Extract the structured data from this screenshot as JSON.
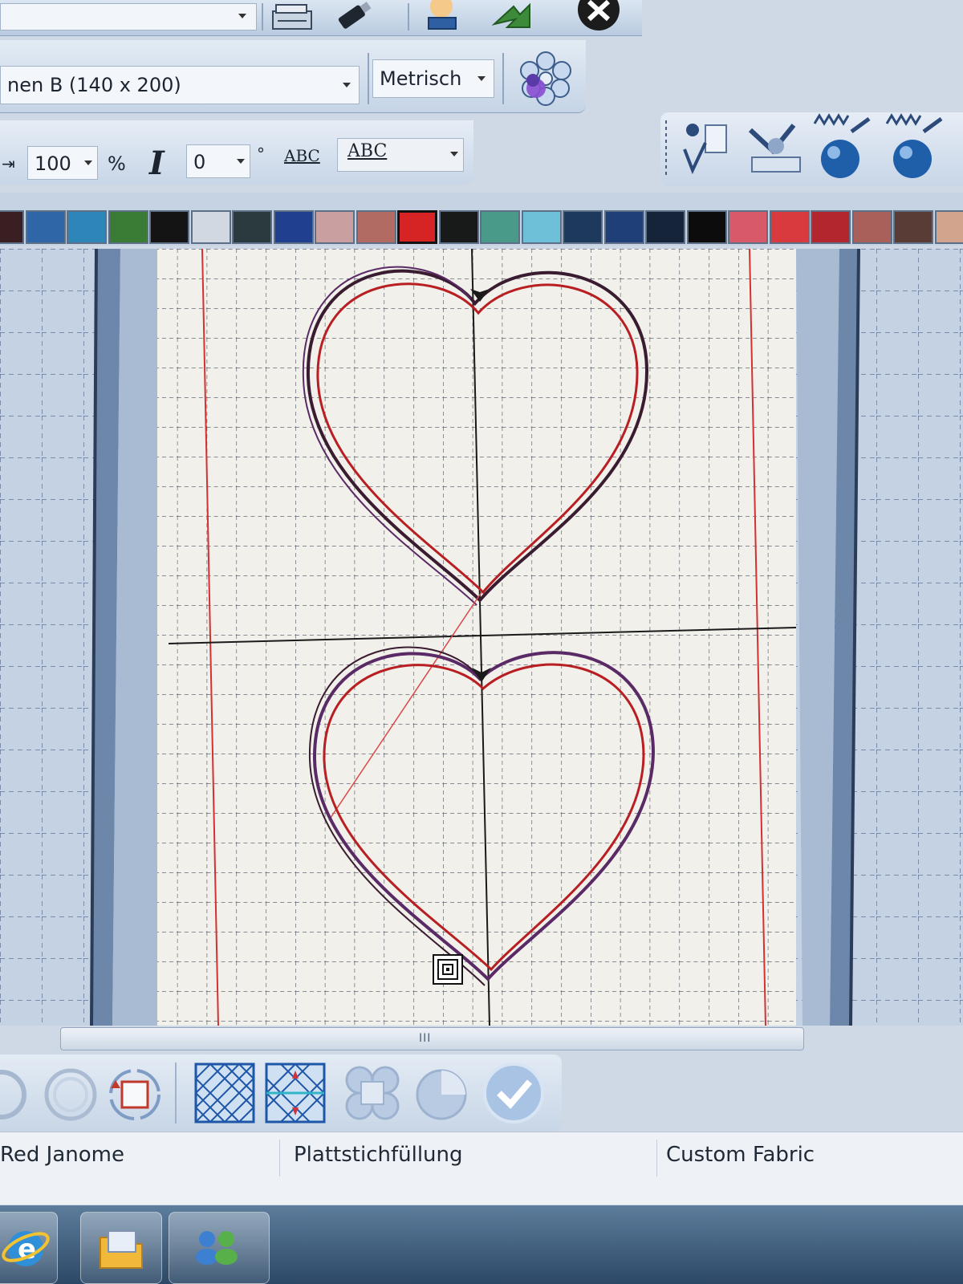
{
  "toolbar_top": {
    "buttons": [
      {
        "icon": "sewing-machine-icon"
      },
      {
        "icon": "usb-stick-icon"
      },
      {
        "icon": "lamp-icon"
      },
      {
        "icon": "export-arrow-icon"
      },
      {
        "icon": "close-icon"
      }
    ]
  },
  "hoop": {
    "selected": "nen B (140 x 200)",
    "units": "Metrisch",
    "icon": "flower-icon"
  },
  "text_toolbar": {
    "size_value": "100",
    "size_unit": "%",
    "italic_label": "I",
    "angle_value": "0",
    "angle_unit": "°",
    "abc_style_label": "ABC",
    "abc_font_label": "ABC"
  },
  "right_tools": [
    {
      "icon": "stitch-info-icon"
    },
    {
      "icon": "hoop-view-icon"
    },
    {
      "icon": "apple-stitch-icon"
    },
    {
      "icon": "apple-stitch-2-icon"
    }
  ],
  "palette": {
    "colors": [
      "#3a1f22",
      "#2f66a8",
      "#2e86b8",
      "#3a7c35",
      "#141414",
      "#d2d8e2",
      "#2a3a3f",
      "#203f8e",
      "#c9a09f",
      "#b26b63",
      "#d62424",
      "#181a1a",
      "#4a9a8a",
      "#6ec0d8",
      "#1d3a5c",
      "#1e3f77",
      "#152439",
      "#0c0c0c",
      "#d85a68",
      "#d93a3e",
      "#b3262d",
      "#a9605b",
      "#5a3c37",
      "#d3a48d"
    ],
    "selected_index": 10
  },
  "bottom_tools": [
    {
      "icon": "shape-circle-icon"
    },
    {
      "icon": "shape-double-circle-icon"
    },
    {
      "icon": "rotate-square-icon"
    },
    {
      "icon": "fill-pattern-icon"
    },
    {
      "icon": "fill-direction-icon"
    },
    {
      "icon": "puzzle-icon"
    },
    {
      "icon": "pie-icon"
    },
    {
      "icon": "checkmark-icon"
    }
  ],
  "scrollbar": {
    "grip": "III"
  },
  "status": {
    "thread": "Red Janome",
    "fill": "Plattstichfüllung",
    "fabric": "Custom Fabric"
  },
  "taskbar": [
    {
      "icon": "internet-explorer-icon"
    },
    {
      "icon": "folder-icon"
    },
    {
      "icon": "network-users-icon"
    }
  ]
}
